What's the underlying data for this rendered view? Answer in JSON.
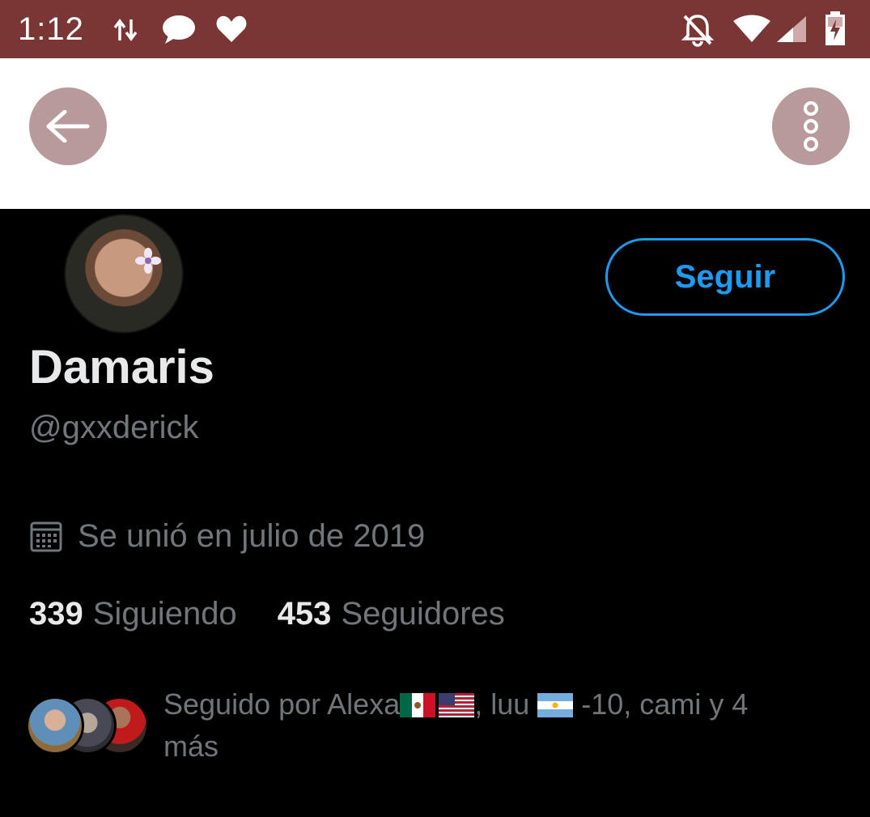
{
  "status_bar": {
    "time": "1:12",
    "icons": [
      "data-transfer-icon",
      "chat-bubble-icon",
      "heart-icon",
      "notifications-off-icon",
      "wifi-icon",
      "signal-icon",
      "battery-charging-icon"
    ]
  },
  "header": {
    "back_icon": "arrow-left-icon",
    "more_icon": "more-vertical-icon",
    "button_color": "#b99a9c"
  },
  "profile": {
    "display_name": "Damaris",
    "handle": "@gxxderick",
    "follow_label": "Seguir",
    "joined_text": "Se unió en julio de 2019",
    "following_count": "339",
    "following_label": "Siguiendo",
    "followers_count": "453",
    "followers_label": "Seguidores",
    "followed_by": {
      "prefix": "Seguido por Alexa",
      "middle": ", luu ",
      "suffix": " -10, cami y 4 más",
      "flags": [
        "mexico-flag",
        "usa-flag",
        "argentina-flag"
      ]
    }
  },
  "colors": {
    "status_bar": "#7a3535",
    "accent": "#1d9bf0",
    "primary_text": "#e7e9ea",
    "secondary_text": "#71767b",
    "background": "#000000"
  }
}
